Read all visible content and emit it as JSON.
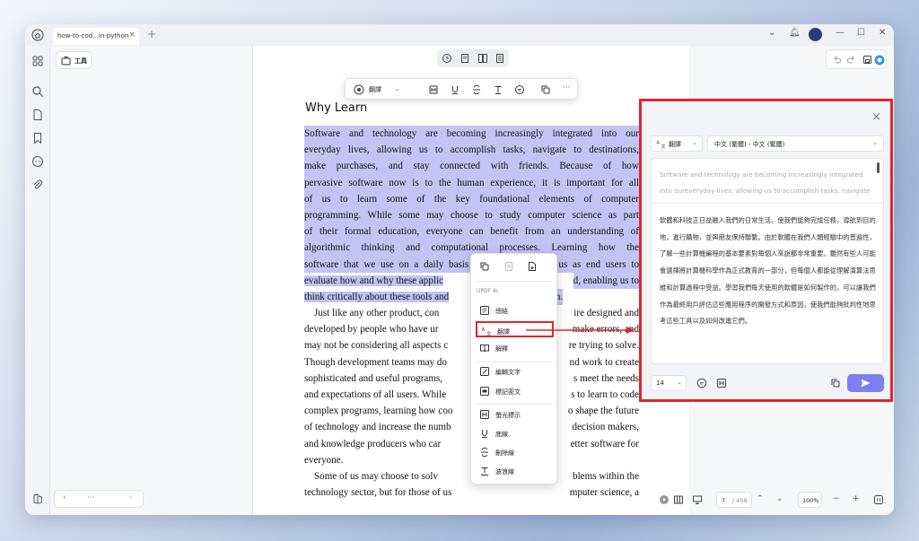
{
  "tab": {
    "title": "how-to-cod...in-python"
  },
  "sidebar": {
    "tools_label": "工具"
  },
  "pager": {
    "prev": "‹",
    "dots": "···",
    "next": "›"
  },
  "document": {
    "heading": "Why Learn",
    "para1_lines": [
      "Software and technology are becoming increasingly integrated into our",
      "everyday lives, allowing us to accomplish tasks, navigate to destinations,",
      "make purchases, and stay connected with friends. Because of how",
      "pervasive software now is to the human experience, it is important for all",
      "of us to learn some of the key foundational elements of computer",
      "programming. While some may choose to study computer science as part",
      "of their formal education, everyone can benefit from an understanding of",
      "algorithmic thinking and computational processes. Learning how the",
      "software that we use on a daily basis is made can allow us as end users to",
      "evaluate how and why these applic",
      "think critically about these tools and"
    ],
    "para1_tail_a": "d, enabling us to",
    "para1_tail_b": "em.",
    "para2_lines_left": [
      "Just like any other product, con",
      "developed by people who have ur",
      "may not be considering all aspects c",
      "Though development teams may do",
      "sophisticated and useful programs,",
      "and expectations of all users. While",
      "complex programs, learning how coo",
      "of technology and increase the numb",
      "and knowledge producers who car"
    ],
    "para2_lines_right": [
      "ire designed and",
      "make errors, and",
      "re trying to solve.",
      "nd work to create",
      "s meet the needs",
      "s to learn to code",
      "o shape the future",
      "decision makers,",
      "etter software for"
    ],
    "para2_last": "everyone.",
    "para3_left": [
      "Some of us may choose to solv",
      "technology sector, but for those of us"
    ],
    "para3_right": [
      "blems within the",
      "mputer science, a"
    ]
  },
  "float_toolbar": {
    "translate_label": "翻譯"
  },
  "context_menu": {
    "section_label": "UPDF AI",
    "items": [
      {
        "label": "總結",
        "icon": "summary-icon"
      },
      {
        "label": "翻譯",
        "icon": "translate-icon",
        "active": true
      },
      {
        "label": "解釋",
        "icon": "explain-icon"
      },
      {
        "label": "編輯文字",
        "icon": "edit-text-icon"
      },
      {
        "label": "標記密文",
        "icon": "redact-icon"
      },
      {
        "label": "螢光標示",
        "icon": "highlight-icon"
      },
      {
        "label": "底線",
        "icon": "underline-icon"
      },
      {
        "label": "刪除線",
        "icon": "strikethrough-icon"
      },
      {
        "label": "波浪線",
        "icon": "squiggly-icon"
      }
    ]
  },
  "translate_panel": {
    "mode_label": "翻譯",
    "language": "中文 (繁體) - 中文 (繁體)",
    "source_text": "Software and technology are becoming increasingly integrated into oureveryday lives, allowing us to accomplish tasks, navigate",
    "output_text": "軟體和科技正日益融入我們的日常生活，使我們能夠完成任務，導航到目的地，進行購物，並與朋友保持聯繫。由於軟體在我們人類經驗中的普遍性，了解一些計算機編程的基本要素對每個人來說都非常重要。雖然有些人可能會選擇將計算機科學作為正式教育的一部分，但每個人都能從理解演算法思維和計算過程中受益。學習我們每天使用的軟體是如何製作的，可以讓我們作為最終用戶評估這些應用程序的開發方式和原因，使我們能夠批判性地思考這些工具以及如何改進它們。",
    "font_size": "14"
  },
  "status_bar": {
    "page_current": "7",
    "page_total": "/ 459",
    "zoom": "100%"
  },
  "colors": {
    "accent_red": "#e0262b",
    "highlight": "#c3c4f4",
    "send_button": "#7b7ff0"
  }
}
